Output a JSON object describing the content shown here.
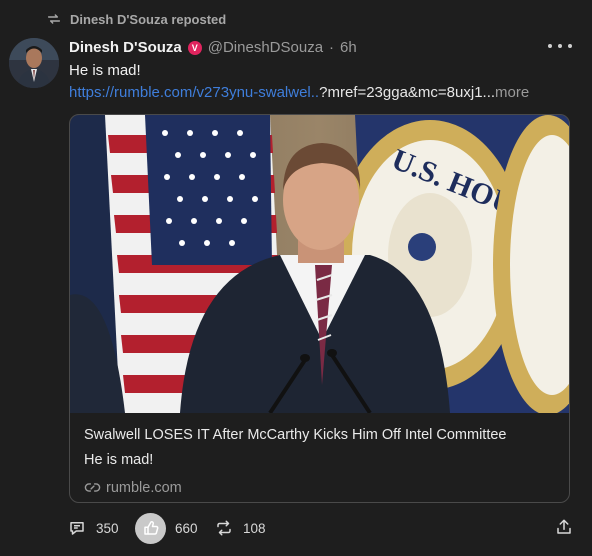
{
  "repost": {
    "label": "Dinesh D'Souza reposted"
  },
  "post": {
    "author_name": "Dinesh D'Souza",
    "verified_glyph": "V",
    "handle": "@DineshDSouza",
    "dot": "·",
    "time": "6h",
    "text": "He is mad!",
    "link_url": "https://rumble.com/v273ynu-swalwel..",
    "link_rest": "?mref=23gga&mc=8uxj1...",
    "link_more": "more"
  },
  "card": {
    "title": "Swalwell LOSES IT After McCarthy Kicks Him Off Intel Committee",
    "subtitle": "He is mad!",
    "domain": "rumble.com",
    "seal_text": "U.S. HOUSE OF REPRESENTATIVES"
  },
  "actions": {
    "replies": "350",
    "likes": "660",
    "reposts": "108"
  },
  "icons": [
    "repost-icon",
    "verified-icon",
    "more-icon",
    "link-icon",
    "reply-icon",
    "like-icon",
    "repost-action-icon",
    "share-icon"
  ],
  "colors": {
    "background": "#1e1e1e",
    "link": "#3f7edb",
    "verified": "#e0245e",
    "muted": "#9a9a9a"
  }
}
